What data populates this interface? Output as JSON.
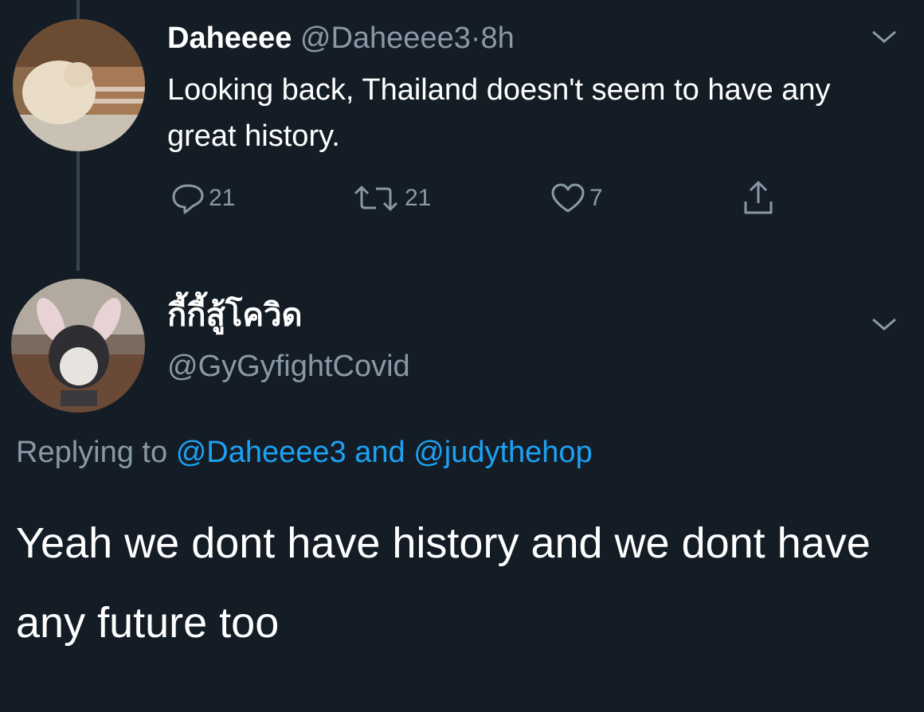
{
  "original_tweet": {
    "display_name": "Daheeee",
    "handle": "@Daheeee3",
    "separator": "·",
    "time": "8h",
    "text": "Looking back, Thailand doesn't seem to have any great history.",
    "replies": "21",
    "retweets": "21",
    "likes": "7"
  },
  "reply_tweet": {
    "display_name": "กี้กี้สู้โควิด",
    "handle": "@GyGyfightCovid",
    "replying_prefix": "Replying to",
    "replying_user_1": "@Daheeee3",
    "replying_conjunction": "and",
    "replying_user_2": "@judythehop",
    "text": "Yeah we dont have history and we dont have any future too"
  },
  "colors": {
    "background": "#141d26",
    "muted": "#8899a6",
    "link": "#1da1f2",
    "text": "#ffffff"
  },
  "icons": [
    "reply-icon",
    "retweet-icon",
    "like-icon",
    "share-icon",
    "chevron-down-icon"
  ]
}
